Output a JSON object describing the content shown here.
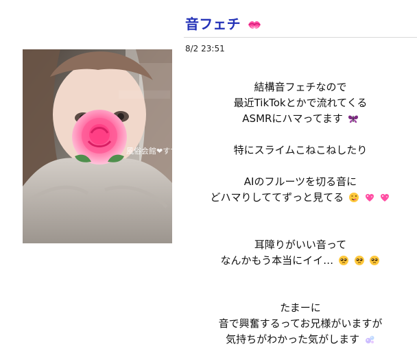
{
  "post": {
    "title": "音フェチ",
    "date": "8/2 23:51",
    "watermark": "風俗会館❤すずり",
    "lines": [
      "結構音フェチなので",
      "最近TikTokとかで流れてくる",
      "ASMRにハマってます",
      "特にスライムこねこねしたり",
      "AIのフルーツを切る音に",
      "どハマりしててずっと見てる",
      "耳障りがいい音って",
      "なんかもう本当にイイ…",
      "たまーに",
      "音で興奮するってお兄様がいますが",
      "気持ちがわかった気がします"
    ],
    "icons": {
      "title": "kiss-lips-icon",
      "butterfly": "butterfly-icon",
      "tongue": "winking-tongue-face-icon",
      "heart": "sparkling-heart-icon",
      "pleading": "pleading-face-icon",
      "bubbles": "bubbles-icon"
    }
  },
  "colors": {
    "title": "#2331b7",
    "accent": "#ff4fa3"
  }
}
